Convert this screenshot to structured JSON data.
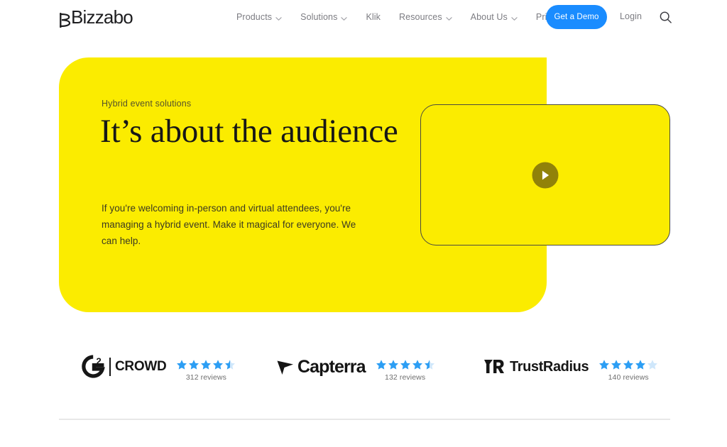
{
  "header": {
    "logo": {
      "text": "Bizzabo",
      "icon": "bizzabo-logo-mark"
    },
    "nav_items": [
      {
        "label": "Products",
        "has_dropdown": true
      },
      {
        "label": "Solutions",
        "has_dropdown": true
      },
      {
        "label": "Klik",
        "has_dropdown": false
      },
      {
        "label": "Resources",
        "has_dropdown": true
      },
      {
        "label": "About Us",
        "has_dropdown": true
      },
      {
        "label": "Pricing",
        "has_dropdown": false
      }
    ],
    "cta_label": "Get a Demo",
    "cta_color": "#1a8cff",
    "login_label": "Login",
    "search_icon": "search-icon"
  },
  "hero": {
    "background_color": "#fbec00",
    "eyebrow": "Hybrid event solutions",
    "headline": "It’s about the audience",
    "subcopy": "If you're welcoming in-person and virtual attendees, you're managing a hybrid event. Make it magical for everyone. We can help.",
    "video": {
      "play_icon": "play-icon",
      "play_button_color": "#918209",
      "border_color": "#4a4a40"
    }
  },
  "reviews": {
    "star_color": "#2c9ef4",
    "star_empty_color": "#cfe7fb",
    "items": [
      {
        "brand": "G2 CROWD",
        "brand_mark": "g2-crowd-logo",
        "brand_primary": "G",
        "brand_superscript": "2",
        "brand_secondary": "CROWD",
        "rating": 4.5,
        "reviews_text": "312 reviews"
      },
      {
        "brand": "Capterra",
        "brand_mark": "capterra-logo",
        "brand_secondary": "Capterra",
        "rating": 4.5,
        "reviews_text": "132 reviews"
      },
      {
        "brand": "TrustRadius",
        "brand_mark": "trustradius-logo",
        "brand_secondary": "TrustRadius",
        "rating": 4.0,
        "reviews_text": "140 reviews"
      }
    ]
  }
}
